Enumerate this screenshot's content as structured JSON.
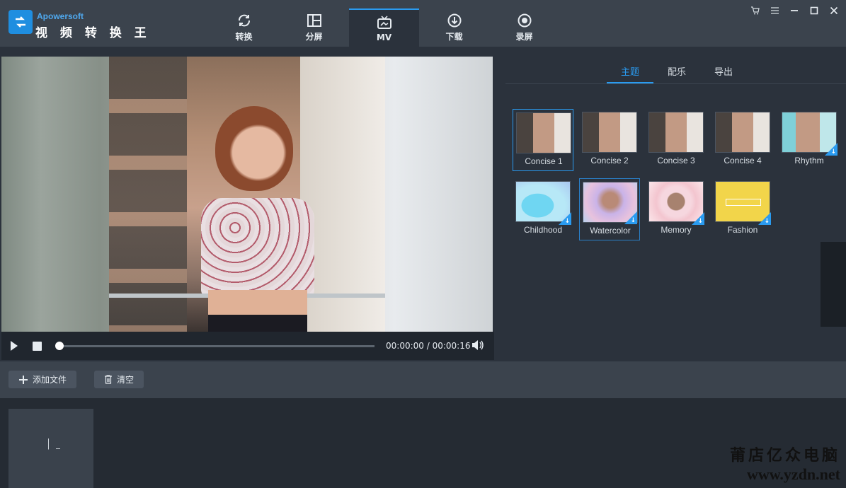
{
  "header": {
    "brand": "Apowersoft",
    "app_title": "视 频 转 换 王",
    "tabs": [
      {
        "label": "转换",
        "icon": "refresh-icon"
      },
      {
        "label": "分屏",
        "icon": "split-screen-icon"
      },
      {
        "label": "MV",
        "icon": "tv-icon",
        "active": true
      },
      {
        "label": "下载",
        "icon": "download-icon"
      },
      {
        "label": "录屏",
        "icon": "record-icon"
      }
    ],
    "window_controls": [
      "cart-icon",
      "menu-icon",
      "minimize-icon",
      "maximize-icon",
      "close-icon"
    ]
  },
  "player": {
    "time": "00:00:00 / 00:00:16",
    "progress": 0
  },
  "right_panel": {
    "tabs": [
      "主题",
      "配乐",
      "导出"
    ],
    "active_tab": 0,
    "themes": [
      {
        "label": "Concise 1",
        "selected": true,
        "download": false
      },
      {
        "label": "Concise 2",
        "download": false
      },
      {
        "label": "Concise 3",
        "download": false
      },
      {
        "label": "Concise 4",
        "download": false
      },
      {
        "label": "Rhythm",
        "download": true
      },
      {
        "label": "Childhood",
        "download": true
      },
      {
        "label": "Watercolor",
        "download": true,
        "highlighted": true
      },
      {
        "label": "Memory",
        "download": true
      },
      {
        "label": "Fashion",
        "download": true
      }
    ]
  },
  "toolbar": {
    "add_file": "添加文件",
    "clear": "清空"
  },
  "watermark": {
    "line1": "莆店亿众电脑",
    "line2": "www.yzdn.net"
  },
  "colors": {
    "accent": "#2a9bf0",
    "header_bg": "#3b434d",
    "body_bg": "#2b323c"
  }
}
